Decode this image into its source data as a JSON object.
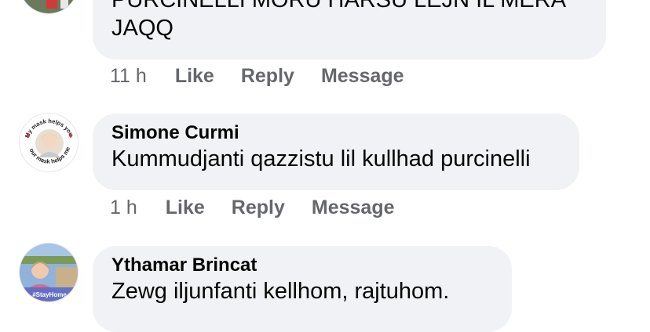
{
  "comments": [
    {
      "author": "",
      "text_lines": [
        "PURCINELLI MORU HARSU LEJN IL MERA",
        "JAQQ"
      ],
      "time": "11 h",
      "like": "Like",
      "reply": "Reply",
      "message": "Message"
    },
    {
      "author": "Simone Curmi",
      "text": "Kummudjanti qazzistu lil kullhad purcinelli",
      "avatar_frame_text_top": "My mask helps you.",
      "avatar_frame_text_bottom": "Your mask helps me.",
      "time": "1 h",
      "like": "Like",
      "reply": "Reply",
      "message": "Message"
    },
    {
      "author": "Ythamar Brincat",
      "text": "Zewg iljunfanti kellhom, rajtuhom.",
      "avatar_badge": "#StayHome"
    }
  ],
  "colors": {
    "bubble": "#f0f2f5",
    "meta_text": "#65676b",
    "text": "#050505"
  }
}
